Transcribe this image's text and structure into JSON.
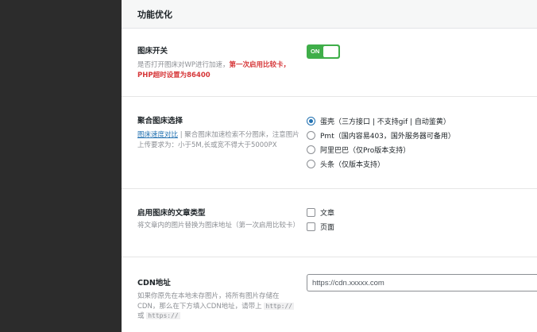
{
  "section": {
    "title": "功能优化"
  },
  "image_host_switch": {
    "label": "图床开关",
    "desc_prefix": "是否打开图床对WP进行加速，",
    "desc_highlight": "第一次启用比较卡，PHP超时设置为86400",
    "toggle_text": "ON",
    "enabled": true
  },
  "aggregate_host": {
    "label": "聚合图床选择",
    "desc_link": "图床速度对比",
    "desc_rest": " | 聚合图床加速检索不分图床，注意图片上传要求为：小于5M,长或宽不得大于5000PX",
    "options": [
      {
        "label": "蛋壳（三方接口 | 不支持gif | 自动鉴黄）",
        "selected": true
      },
      {
        "label": "Pmt（国内容易403，国外服务器可备用）",
        "selected": false
      },
      {
        "label": "阿里巴巴（仅Pro版本支持）",
        "selected": false
      },
      {
        "label": "头条（仅版本支持）",
        "selected": false
      }
    ]
  },
  "post_types": {
    "label": "启用图床的文章类型",
    "desc": "将文章内的图片替换为图床地址（第一次启用比较卡）",
    "options": [
      {
        "label": "文章",
        "checked": false
      },
      {
        "label": "页面",
        "checked": false
      }
    ]
  },
  "cdn": {
    "label": "CDN地址",
    "desc_prefix": "如果你原先在本地未存图片，将所有图片存储在CDN，那么在下方填入CDN地址，请带上",
    "code1": "http://",
    "or": " 或 ",
    "code2": "https://",
    "placeholder": "https://cdn.xxxxx.com",
    "value": ""
  },
  "colors": {
    "toggle_on": "#3fae49",
    "highlight_red": "#d63638",
    "link_blue": "#2271b1",
    "sidebar": "#2c2c2c"
  }
}
